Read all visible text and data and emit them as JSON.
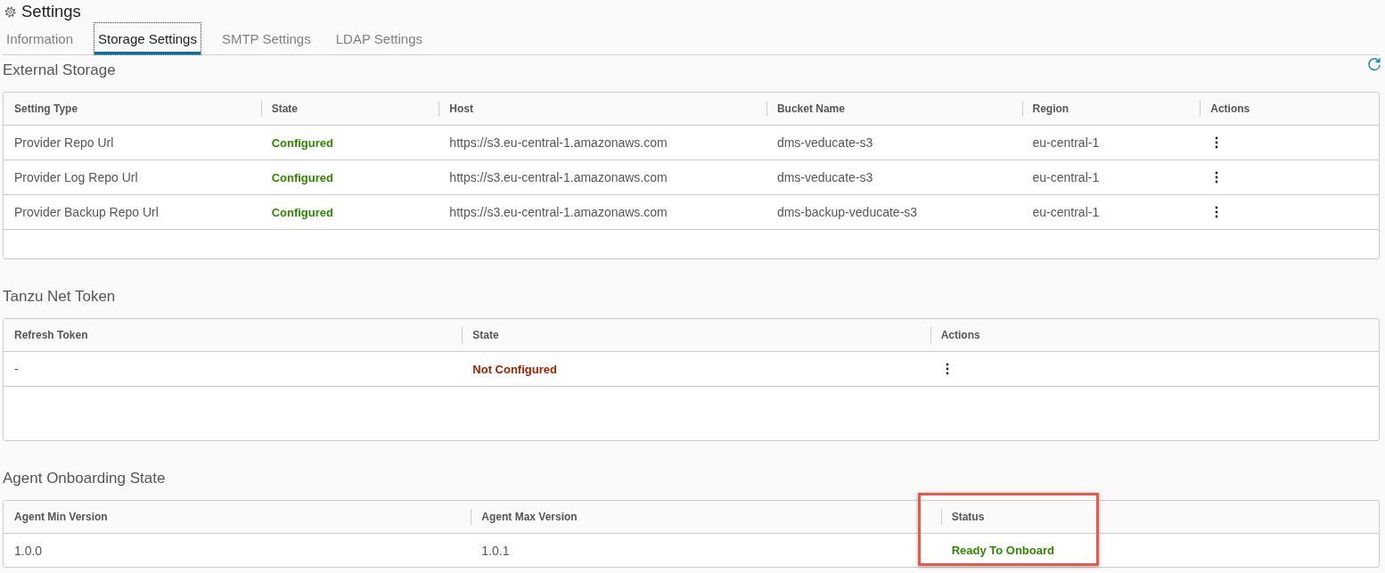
{
  "header": {
    "title": "Settings"
  },
  "tabs": [
    {
      "label": "Information",
      "selected": false
    },
    {
      "label": "Storage Settings",
      "selected": true
    },
    {
      "label": "SMTP Settings",
      "selected": false
    },
    {
      "label": "LDAP Settings",
      "selected": false
    }
  ],
  "sections": [
    {
      "title": "External Storage",
      "columns": [
        {
          "label": "Setting Type",
          "kind": "text"
        },
        {
          "label": "State",
          "kind": "status"
        },
        {
          "label": "Host",
          "kind": "text"
        },
        {
          "label": "Bucket Name",
          "kind": "text"
        },
        {
          "label": "Region",
          "kind": "text"
        },
        {
          "label": "Actions",
          "kind": "actions"
        }
      ],
      "rows": [
        {
          "cells": [
            "Provider Repo Url",
            "Configured",
            "https://s3.eu-central-1.amazonaws.com",
            "dms-veducate-s3",
            "eu-central-1"
          ],
          "ok": true
        },
        {
          "cells": [
            "Provider Log Repo Url",
            "Configured",
            "https://s3.eu-central-1.amazonaws.com",
            "dms-veducate-s3",
            "eu-central-1"
          ],
          "ok": true
        },
        {
          "cells": [
            "Provider Backup Repo Url",
            "Configured",
            "https://s3.eu-central-1.amazonaws.com",
            "dms-backup-veducate-s3",
            "eu-central-1"
          ],
          "ok": true
        }
      ]
    },
    {
      "title": "Tanzu Net Token",
      "columns": [
        {
          "label": "Refresh Token",
          "kind": "text"
        },
        {
          "label": "State",
          "kind": "status"
        },
        {
          "label": "Actions",
          "kind": "actions"
        }
      ],
      "rows": [
        {
          "cells": [
            "-",
            "Not Configured"
          ],
          "ok": false
        }
      ]
    },
    {
      "title": "Agent Onboarding State",
      "columns": [
        {
          "label": "Agent Min Version",
          "kind": "text",
          "highlighted": false
        },
        {
          "label": "Agent Max Version",
          "kind": "text",
          "highlighted": false
        },
        {
          "label": "Status",
          "kind": "status",
          "highlighted": true
        }
      ],
      "rows": [
        {
          "cells": [
            "1.0.0",
            "1.0.1",
            "Ready To Onboard"
          ],
          "ok": true
        }
      ]
    }
  ]
}
